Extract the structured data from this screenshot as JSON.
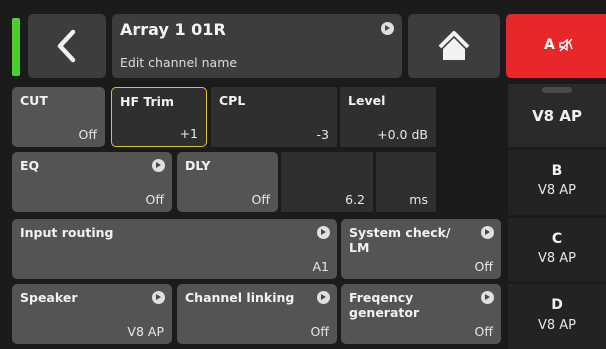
{
  "header": {
    "title": "Array 1 01R",
    "subtitle": "Edit channel name",
    "mute_button_label": "A"
  },
  "tiles": {
    "cut": {
      "label": "CUT",
      "value": "Off"
    },
    "hf_trim": {
      "label": "HF Trim",
      "value": "+1"
    },
    "cpl": {
      "label": "CPL",
      "value": "-3"
    },
    "level": {
      "label": "Level",
      "value": "+0.0 dB"
    },
    "eq": {
      "label": "EQ",
      "value": "Off"
    },
    "dly": {
      "label": "DLY",
      "value": "Off",
      "amount": "6.2",
      "unit": "ms"
    },
    "input_routing": {
      "label": "Input routing",
      "value": "A1"
    },
    "system_check": {
      "label": "System check/ LM",
      "value": "Off"
    },
    "speaker": {
      "label": "Speaker",
      "value": "V8 AP"
    },
    "channel_linking": {
      "label": "Channel linking",
      "value": "Off"
    },
    "frequency_generator": {
      "label": "Freqency generator",
      "value": "Off"
    }
  },
  "channels": [
    {
      "name": "",
      "speaker": "V8 AP"
    },
    {
      "name": "B",
      "speaker": "V8 AP"
    },
    {
      "name": "C",
      "speaker": "V8 AP"
    },
    {
      "name": "D",
      "speaker": "V8 AP"
    }
  ],
  "colors": {
    "accent_green": "#4ccf2a",
    "mute_red": "#e8272b",
    "highlight_yellow": "#d9c72a"
  }
}
